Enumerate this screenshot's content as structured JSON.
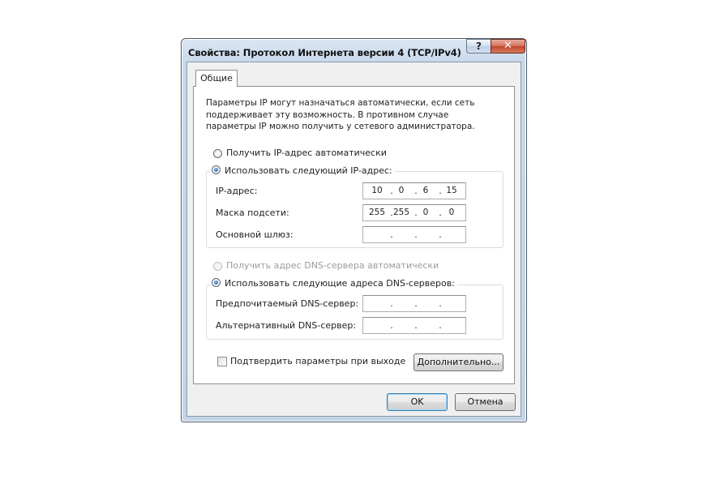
{
  "window": {
    "title": "Свойства: Протокол Интернета версии 4 (TCP/IPv4)",
    "help_label": "?",
    "close_label": "✕"
  },
  "tabs": [
    {
      "label": "Общие",
      "selected": true
    }
  ],
  "description": "Параметры IP могут назначаться автоматически, если сеть поддерживает эту возможность. В противном случае параметры IP можно получить у сетевого администратора.",
  "ip_section": {
    "auto_label": "Получить IP-адрес автоматически",
    "manual_label": "Использовать следующий IP-адрес:",
    "selected": "manual",
    "fields": [
      {
        "label": "IP-адрес:",
        "octets": [
          "10",
          "0",
          "6",
          "15"
        ]
      },
      {
        "label": "Маска подсети:",
        "octets": [
          "255",
          "255",
          "0",
          "0"
        ]
      },
      {
        "label": "Основной шлюз:",
        "octets": [
          "",
          "",
          "",
          ""
        ]
      }
    ]
  },
  "dns_section": {
    "auto_label": "Получить адрес DNS-сервера автоматически",
    "manual_label": "Использовать следующие адреса DNS-серверов:",
    "selected": "manual",
    "auto_disabled": true,
    "fields": [
      {
        "label": "Предпочитаемый DNS-сервер:",
        "octets": [
          "",
          "",
          "",
          ""
        ]
      },
      {
        "label": "Альтернативный DNS-сервер:",
        "octets": [
          "",
          "",
          "",
          ""
        ]
      }
    ]
  },
  "validate_checkbox": {
    "label": "Подтвердить параметры при выходе",
    "checked": false
  },
  "buttons": {
    "advanced": "Дополнительно...",
    "ok": "OK",
    "cancel": "Отмена"
  },
  "colors": {
    "frame": "#c3d4e7",
    "close_button": "#c1442a",
    "radio_dot": "#1c5fa8",
    "default_button_border": "#3c7fb1"
  }
}
